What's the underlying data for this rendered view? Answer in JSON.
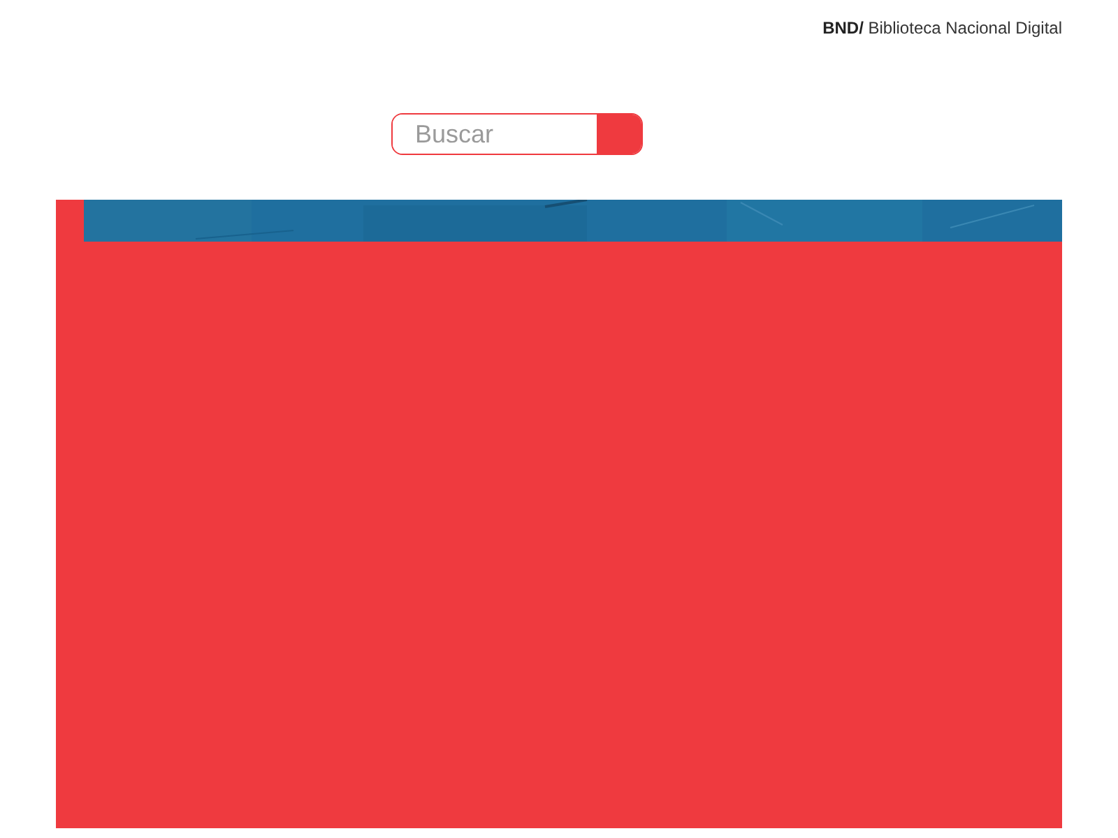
{
  "header": {
    "site_title": "**BND/** Biblioteca Nacional Digital"
  },
  "search": {
    "placeholder": "Buscar"
  }
}
